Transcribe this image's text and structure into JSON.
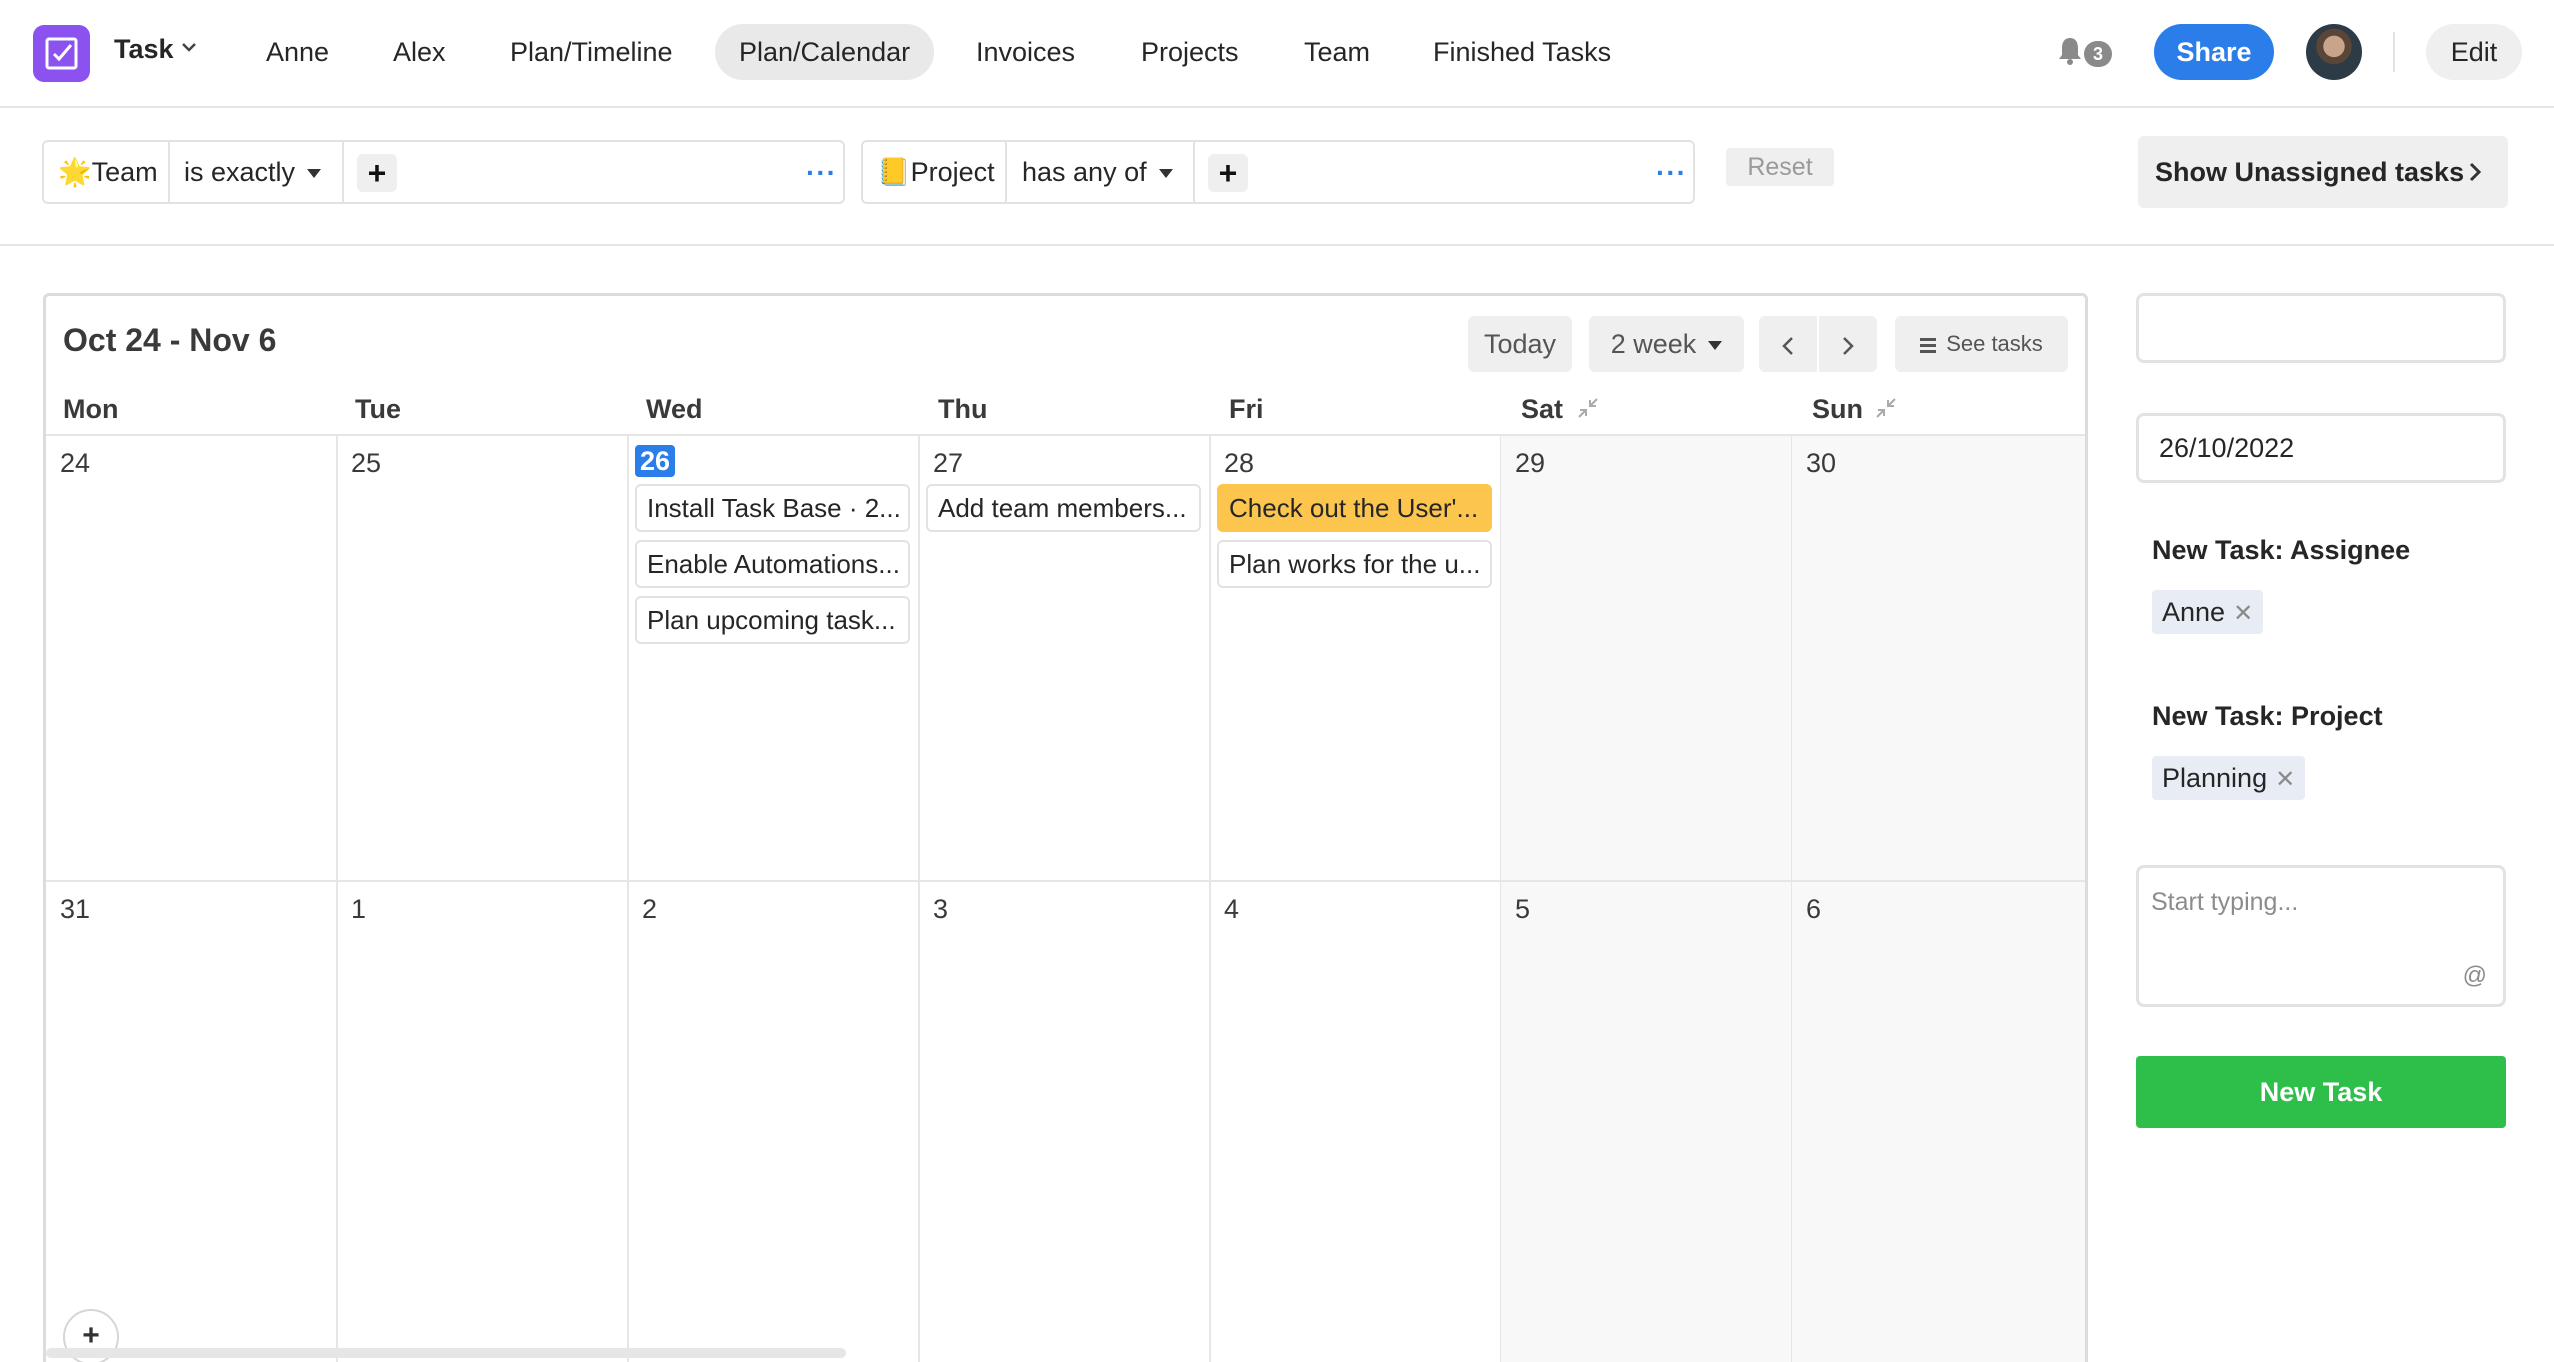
{
  "app": {
    "name": "Task",
    "accent": "#8c52f0"
  },
  "nav": {
    "tabs": [
      {
        "label": "Anne",
        "active": false
      },
      {
        "label": "Alex",
        "active": false
      },
      {
        "label": "Plan/Timeline",
        "active": false
      },
      {
        "label": "Plan/Calendar",
        "active": true
      },
      {
        "label": "Invoices",
        "active": false
      },
      {
        "label": "Projects",
        "active": false
      },
      {
        "label": "Team",
        "active": false
      },
      {
        "label": "Finished Tasks",
        "active": false
      }
    ],
    "notification_count": "3",
    "share_label": "Share",
    "edit_label": "Edit"
  },
  "filters": [
    {
      "icon": "🌟",
      "field": "Team",
      "operator": "is exactly"
    },
    {
      "icon": "📒",
      "field": "Project",
      "operator": "has any of"
    }
  ],
  "filter_add_label": "+",
  "filter_more_label": "···",
  "reset_label": "Reset",
  "show_unassigned_label": "Show Unassigned tasks",
  "calendar": {
    "range": "Oct 24 - Nov 6",
    "today_label": "Today",
    "view_label": "2 week",
    "see_tasks_label": "See tasks",
    "add_label": "+",
    "days_of_week": [
      "Mon",
      "Tue",
      "Wed",
      "Thu",
      "Fri",
      "Sat",
      "Sun"
    ],
    "weeks": [
      {
        "days": [
          {
            "num": "24",
            "today": false,
            "tasks": []
          },
          {
            "num": "25",
            "today": false,
            "tasks": []
          },
          {
            "num": "26",
            "today": true,
            "tasks": [
              "Install Task Base · 2...",
              "Enable Automations...",
              "Plan upcoming task..."
            ]
          },
          {
            "num": "27",
            "today": false,
            "tasks": [
              "Add team members..."
            ]
          },
          {
            "num": "28",
            "today": false,
            "tasks": [
              "Check out the User'...",
              "Plan works for the u..."
            ]
          },
          {
            "num": "29",
            "today": false,
            "tasks": []
          },
          {
            "num": "30",
            "today": false,
            "tasks": []
          }
        ]
      },
      {
        "days": [
          {
            "num": "31",
            "today": false,
            "tasks": []
          },
          {
            "num": "1",
            "today": false,
            "tasks": []
          },
          {
            "num": "2",
            "today": false,
            "tasks": []
          },
          {
            "num": "3",
            "today": false,
            "tasks": []
          },
          {
            "num": "4",
            "today": false,
            "tasks": []
          },
          {
            "num": "5",
            "today": false,
            "tasks": []
          },
          {
            "num": "6",
            "today": false,
            "tasks": []
          }
        ]
      }
    ],
    "highlight_color": "#fcc54e",
    "today_color": "#2b7de9"
  },
  "side_form": {
    "top_field_value": "",
    "date_value": "26/10/2022",
    "assignee_label": "New Task: Assignee",
    "assignee_value": "Anne",
    "project_label": "New Task: Project",
    "project_value": "Planning",
    "chip_remove": "✕",
    "typing_placeholder": "Start typing...",
    "at_symbol": "@",
    "new_task_label": "New Task"
  }
}
